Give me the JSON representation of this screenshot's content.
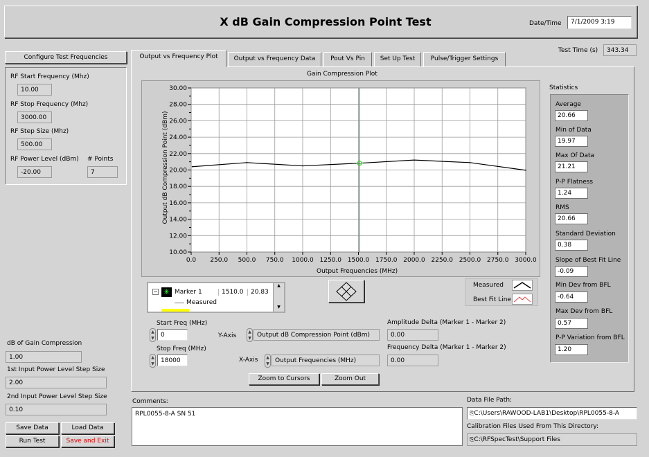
{
  "header": {
    "title": "X dB Gain Compression Point Test",
    "datetime_label": "Date/Time",
    "datetime_value": "7/1/2009   3:19"
  },
  "test_time": {
    "label": "Test Time (s)",
    "value": "343.34"
  },
  "left": {
    "configure_button": "Configure Test Frequencies",
    "rf_start_label": "RF Start Frequency (Mhz)",
    "rf_start_value": "10.00",
    "rf_stop_label": "RF Stop Frequency (Mhz)",
    "rf_stop_value": "3000.00",
    "rf_step_label": "RF Step Size (Mhz)",
    "rf_step_value": "500.00",
    "rf_power_label": "RF Power Level (dBm)",
    "rf_power_value": "-20.00",
    "points_label": "# Points",
    "points_value": "7",
    "db_comp_label": "dB of Gain Compression",
    "db_comp_value": "1.00",
    "step1_label": "1st Input Power Level Step Size",
    "step1_value": "2.00",
    "step2_label": "2nd Input Power Level Step Size",
    "step2_value": "0.10"
  },
  "buttons": {
    "save_data": "Save Data",
    "load_data": "Load Data",
    "run_test": "Run Test",
    "save_exit": "Save and Exit"
  },
  "tabs": [
    "Output vs Frequency Plot",
    "Output vs Frequency Data",
    "Pout Vs Pin",
    "Set Up Test",
    "Pulse/Trigger Settings"
  ],
  "plot": {
    "title": "Gain Compression Plot",
    "legend_measured": "Measured",
    "legend_bestfit": "Best Fit Line",
    "marker_name": "Marker 1",
    "marker_x": "1510.0",
    "marker_y": "20.83",
    "marker_sub": "Measured",
    "start_freq_label": "Start Freq (MHz)",
    "start_freq_value": "0",
    "stop_freq_label": "Stop Freq (MHz)",
    "stop_freq_value": "18000",
    "yaxis_label": "Y-Axis",
    "yaxis_value": "Output dB Compression Point (dBm)",
    "xaxis_label": "X-Axis",
    "xaxis_value": "Output Frequencies (MHz)",
    "amp_delta_label": "Amplitude Delta (Marker 1 - Marker 2)",
    "amp_delta_value": "0.00",
    "freq_delta_label": "Frequency Delta (Marker 1 - Marker 2)",
    "freq_delta_value": "0.00",
    "zoom_cursors": "Zoom to Cursors",
    "zoom_out": "Zoom Out"
  },
  "chart_data": {
    "type": "line",
    "title": "Gain Compression Plot",
    "xlabel": "Output Frequencies (MHz)",
    "ylabel": "Output dB Compression Point (dBm)",
    "xlim": [
      0,
      3000
    ],
    "ylim": [
      10,
      30
    ],
    "x_ticks": [
      "0.0",
      "250.0",
      "500.0",
      "750.0",
      "1000.0",
      "1250.0",
      "1500.0",
      "1750.0",
      "2000.0",
      "2250.0",
      "2500.0",
      "2750.0",
      "3000.0"
    ],
    "y_ticks": [
      "10.00",
      "12.00",
      "14.00",
      "16.00",
      "18.00",
      "20.00",
      "22.00",
      "24.00",
      "26.00",
      "28.00",
      "30.00"
    ],
    "grid": true,
    "series": [
      {
        "name": "Measured",
        "x": [
          10,
          500,
          1000,
          1510,
          2000,
          2500,
          3000
        ],
        "y": [
          20.4,
          20.9,
          20.5,
          20.83,
          21.21,
          20.9,
          19.97
        ]
      }
    ],
    "cursor_x": 1510
  },
  "statistics": {
    "title": "Statistics",
    "items": [
      {
        "label": "Average",
        "value": "20.66"
      },
      {
        "label": "Min of Data",
        "value": "19.97"
      },
      {
        "label": "Max Of Data",
        "value": "21.21"
      },
      {
        "label": "P-P Flatness",
        "value": "1.24"
      },
      {
        "label": "RMS",
        "value": "20.66"
      },
      {
        "label": "Standard Deviation",
        "value": "0.38"
      },
      {
        "label": "Slope of Best Fit Line",
        "value": "-0.09"
      },
      {
        "label": "Min Dev from BFL",
        "value": "-0.64"
      },
      {
        "label": "Max Dev from BFL",
        "value": "0.57"
      },
      {
        "label": "P-P Variation from BFL",
        "value": "1.20"
      }
    ]
  },
  "comments": {
    "label": "Comments:",
    "value": "RPL0055-8-A  SN 51"
  },
  "files": {
    "data_path_label": "Data File Path:",
    "data_path_value": "C:\\Users\\RAWOOD-LAB1\\Desktop\\RPL0055-8-A",
    "cal_label": "Calibration Files Used From This Directory:",
    "cal_value": "C:\\RFSpecTest\\Support Files"
  }
}
